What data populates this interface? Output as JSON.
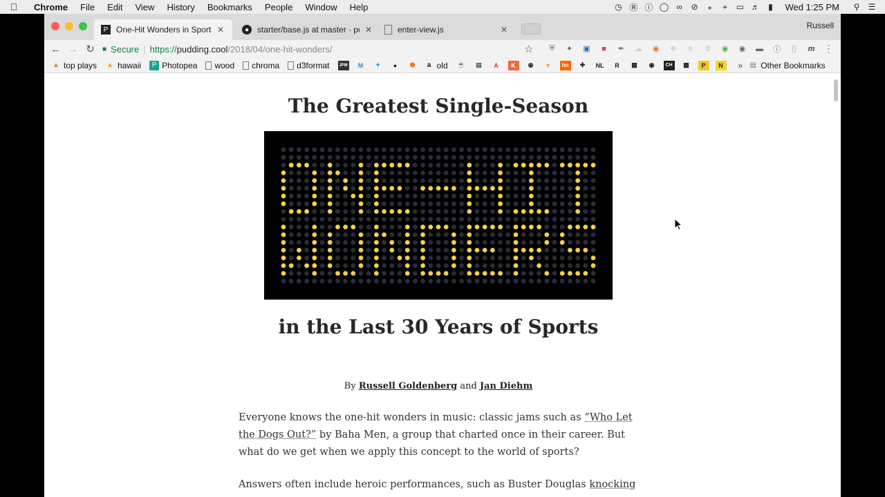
{
  "menubar": {
    "app": "Chrome",
    "items": [
      "File",
      "Edit",
      "View",
      "History",
      "Bookmarks",
      "People",
      "Window",
      "Help"
    ],
    "clock": "Wed 1:25 PM"
  },
  "tabs": [
    {
      "label": "One-Hit Wonders in Sports"
    },
    {
      "label": "starter/base.js at master · polygraph-cool/starter"
    },
    {
      "label": "enter-view.js"
    }
  ],
  "profile": "Russell",
  "omnibox": {
    "secure_label": "Secure",
    "url_scheme": "https://",
    "url_host": "pudding.cool",
    "url_path": "/2018/04/one-hit-wonders/"
  },
  "bookmarks": {
    "items": [
      "top plays",
      "hawaii",
      "Photopea",
      "wood",
      "chroma",
      "d3format",
      "old"
    ],
    "icon_only": [
      "JPM",
      "M",
      "T",
      "F",
      "O",
      "A",
      "C",
      "V",
      "A",
      "K",
      "W",
      "hn",
      "G",
      "NL",
      "R",
      "W",
      "S",
      "CH",
      "S",
      "P",
      "N"
    ],
    "more": "»",
    "other": "Other Bookmarks"
  },
  "article": {
    "title_top": "The Greatest Single-Season",
    "title_bottom": "in the Last 30 Years of Sports",
    "by": "By",
    "author1": "Russell Goldenberg",
    "and": "and",
    "author2": "Jan Diehm",
    "p1_a": "Everyone knows the one-hit wonders in music: classic jams such as ",
    "p1_link": "“Who Let the Dogs Out?”",
    "p1_b": " by Baha Men, a group that charted once in their career. But what do we get when we apply this concept to the world of sports?",
    "p2_a": "Answers often include heroic performances, such as Buster Douglas ",
    "p2_link": "knocking out"
  },
  "hero": {
    "line1": "ONE-HIT",
    "line2": "WONDERS",
    "lit_color": "#f5cf48",
    "dim_color": "#2c2c34"
  }
}
